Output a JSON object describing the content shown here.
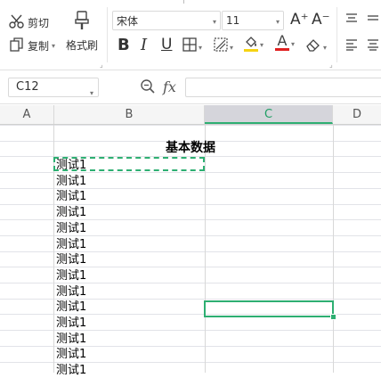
{
  "ribbon": {
    "cut_label": "剪切",
    "copy_label": "复制",
    "format_painter_label": "格式刷",
    "font_name": "宋体",
    "font_size": "11",
    "bold_glyph": "B",
    "italic_glyph": "I",
    "underline_glyph": "U",
    "font_color_glyph": "A",
    "grow_font_glyph": "A⁺",
    "shrink_font_glyph": "A⁻",
    "accent_colors": {
      "highlight": "#f5d313",
      "font_color": "#e02020"
    }
  },
  "formula_bar": {
    "cell_reference": "C12",
    "fx_label": "fx",
    "formula_value": ""
  },
  "columns": [
    {
      "label": "A",
      "active": false
    },
    {
      "label": "B",
      "active": false
    },
    {
      "label": "C",
      "active": true
    },
    {
      "label": "D",
      "active": false
    }
  ],
  "sheet": {
    "title": "基本数据",
    "b_values": [
      "测试1",
      "测试1",
      "测试1",
      "测试1",
      "测试1",
      "测试1",
      "测试1",
      "测试1",
      "测试1",
      "测试1",
      "测试1",
      "测试1",
      "测试1",
      "测试1"
    ]
  },
  "theme": {
    "selection_color": "#2eaf72",
    "active_column_bg": "#d5d5db"
  }
}
